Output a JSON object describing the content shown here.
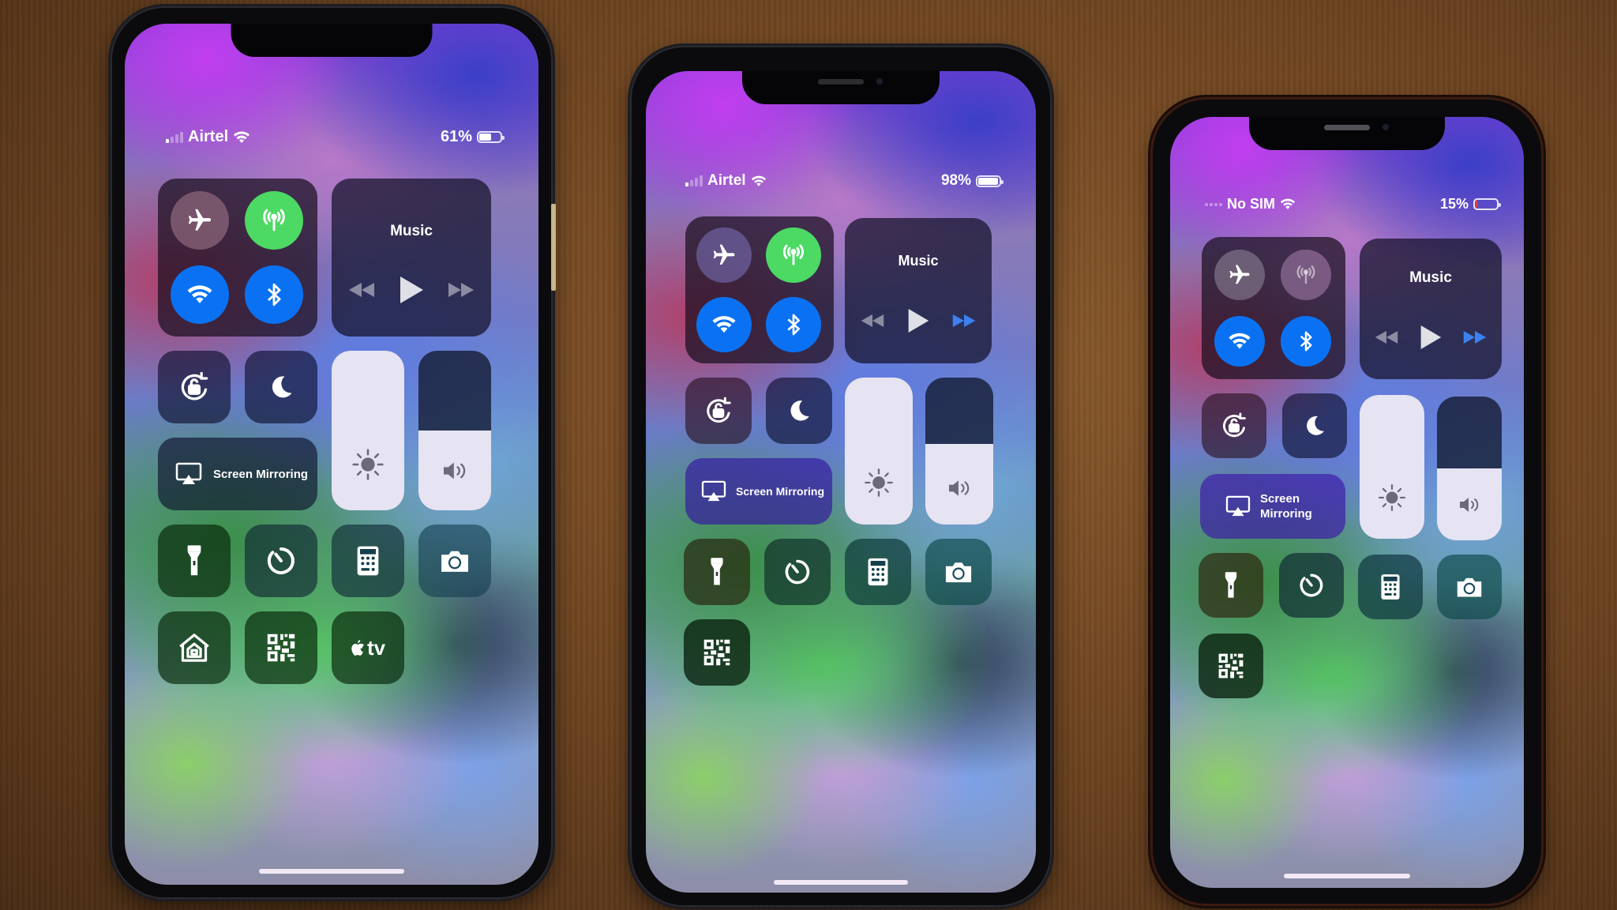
{
  "scene": {
    "description": "Three iPhones showing iOS Control Center on a wooden table"
  },
  "phones": [
    {
      "id": "left",
      "status": {
        "carrier": "Airtel",
        "signal_bars": 1,
        "signal_max": 4,
        "wifi": true,
        "battery_text": "61%",
        "battery_level": 0.61,
        "battery_color": "#ffffff"
      },
      "connectivity": {
        "airplane": false,
        "cellular": true,
        "wifi": true,
        "bluetooth": true
      },
      "music": {
        "title": "Music",
        "forward_active": false
      },
      "brightness_level": 1.0,
      "volume_level": 0.5,
      "screen_mirroring_label": "Screen Mirroring",
      "shortcuts_row1": [
        "flashlight-icon",
        "timer-icon",
        "calculator-icon",
        "camera-icon"
      ],
      "shortcuts_row2": [
        "home-icon",
        "qr-code-icon",
        "apple-tv-icon"
      ],
      "apple_tv_label": "tv"
    },
    {
      "id": "middle",
      "status": {
        "carrier": "Airtel",
        "signal_bars": 1,
        "signal_max": 4,
        "wifi": true,
        "battery_text": "98%",
        "battery_level": 0.98,
        "battery_color": "#ffffff"
      },
      "connectivity": {
        "airplane": false,
        "cellular": true,
        "wifi": true,
        "bluetooth": true
      },
      "music": {
        "title": "Music",
        "forward_active": true
      },
      "brightness_level": 1.0,
      "volume_level": 0.55,
      "screen_mirroring_label": "Screen Mirroring",
      "shortcuts_row1": [
        "flashlight-icon",
        "timer-icon",
        "calculator-icon",
        "camera-icon"
      ],
      "shortcuts_row2": [
        "qr-code-icon"
      ]
    },
    {
      "id": "right",
      "status": {
        "carrier": "No SIM",
        "signal_bars": 0,
        "signal_max": 4,
        "wifi": true,
        "battery_text": "15%",
        "battery_level": 0.15,
        "battery_color": "#ff3b30"
      },
      "connectivity": {
        "airplane": false,
        "cellular": false,
        "wifi": true,
        "bluetooth": true
      },
      "music": {
        "title": "Music",
        "forward_active": true
      },
      "brightness_level": 1.0,
      "volume_level": 0.5,
      "screen_mirroring_label": "Screen\nMirroring",
      "screen_mirroring_lines": [
        "Screen",
        "Mirroring"
      ],
      "shortcuts_row1": [
        "flashlight-icon",
        "timer-icon",
        "calculator-icon",
        "camera-icon"
      ],
      "shortcuts_row2": [
        "qr-code-icon"
      ]
    }
  ],
  "colors": {
    "cellular_on": "#4cd964",
    "toggle_blue": "#0a72f2",
    "slider_fill": "#e6e3f3",
    "battery_low": "#ff3b30"
  }
}
